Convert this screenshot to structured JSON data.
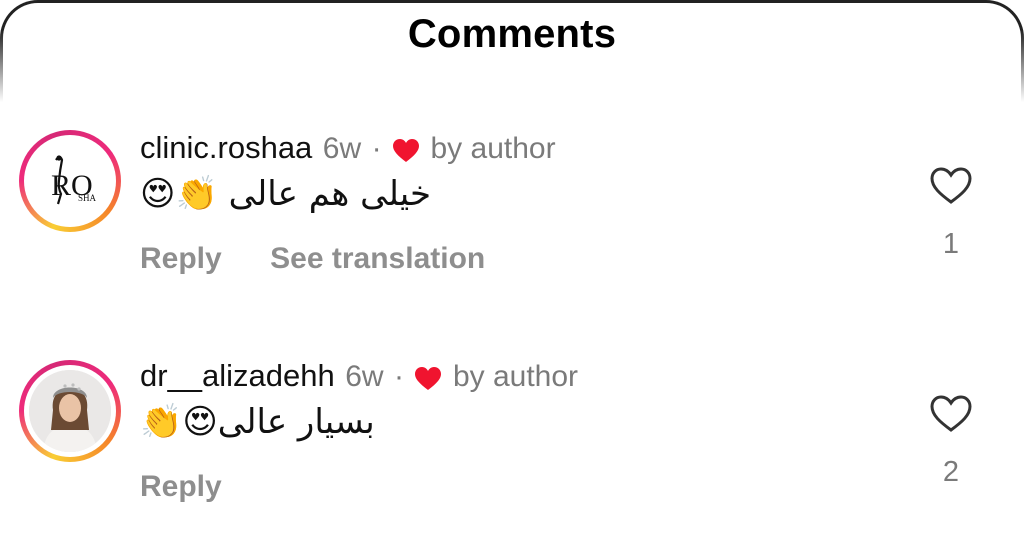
{
  "header": {
    "title": "Comments"
  },
  "comments": [
    {
      "username": "clinic.roshaa",
      "time": "6w",
      "separator": "·",
      "liked_by_author_label": "by author",
      "text": "خیلی هم عالی 👏😍",
      "reply_label": "Reply",
      "translate_label": "See translation",
      "like_count": "1",
      "avatar": {
        "logo_text": "RO",
        "logo_sub": "SHA"
      }
    },
    {
      "username": "dr__alizadehh",
      "time": "6w",
      "separator": "·",
      "liked_by_author_label": "by author",
      "text": "بسیار عالی😍👏",
      "reply_label": "Reply",
      "like_count": "2"
    }
  ],
  "colors": {
    "author_heart": "#f0142f",
    "muted": "#8e8e8e",
    "ring_start": "#f9ce34",
    "ring_mid": "#ee2a7b"
  },
  "icons": {
    "like": "heart-outline-icon",
    "author_like": "heart-filled-icon"
  }
}
